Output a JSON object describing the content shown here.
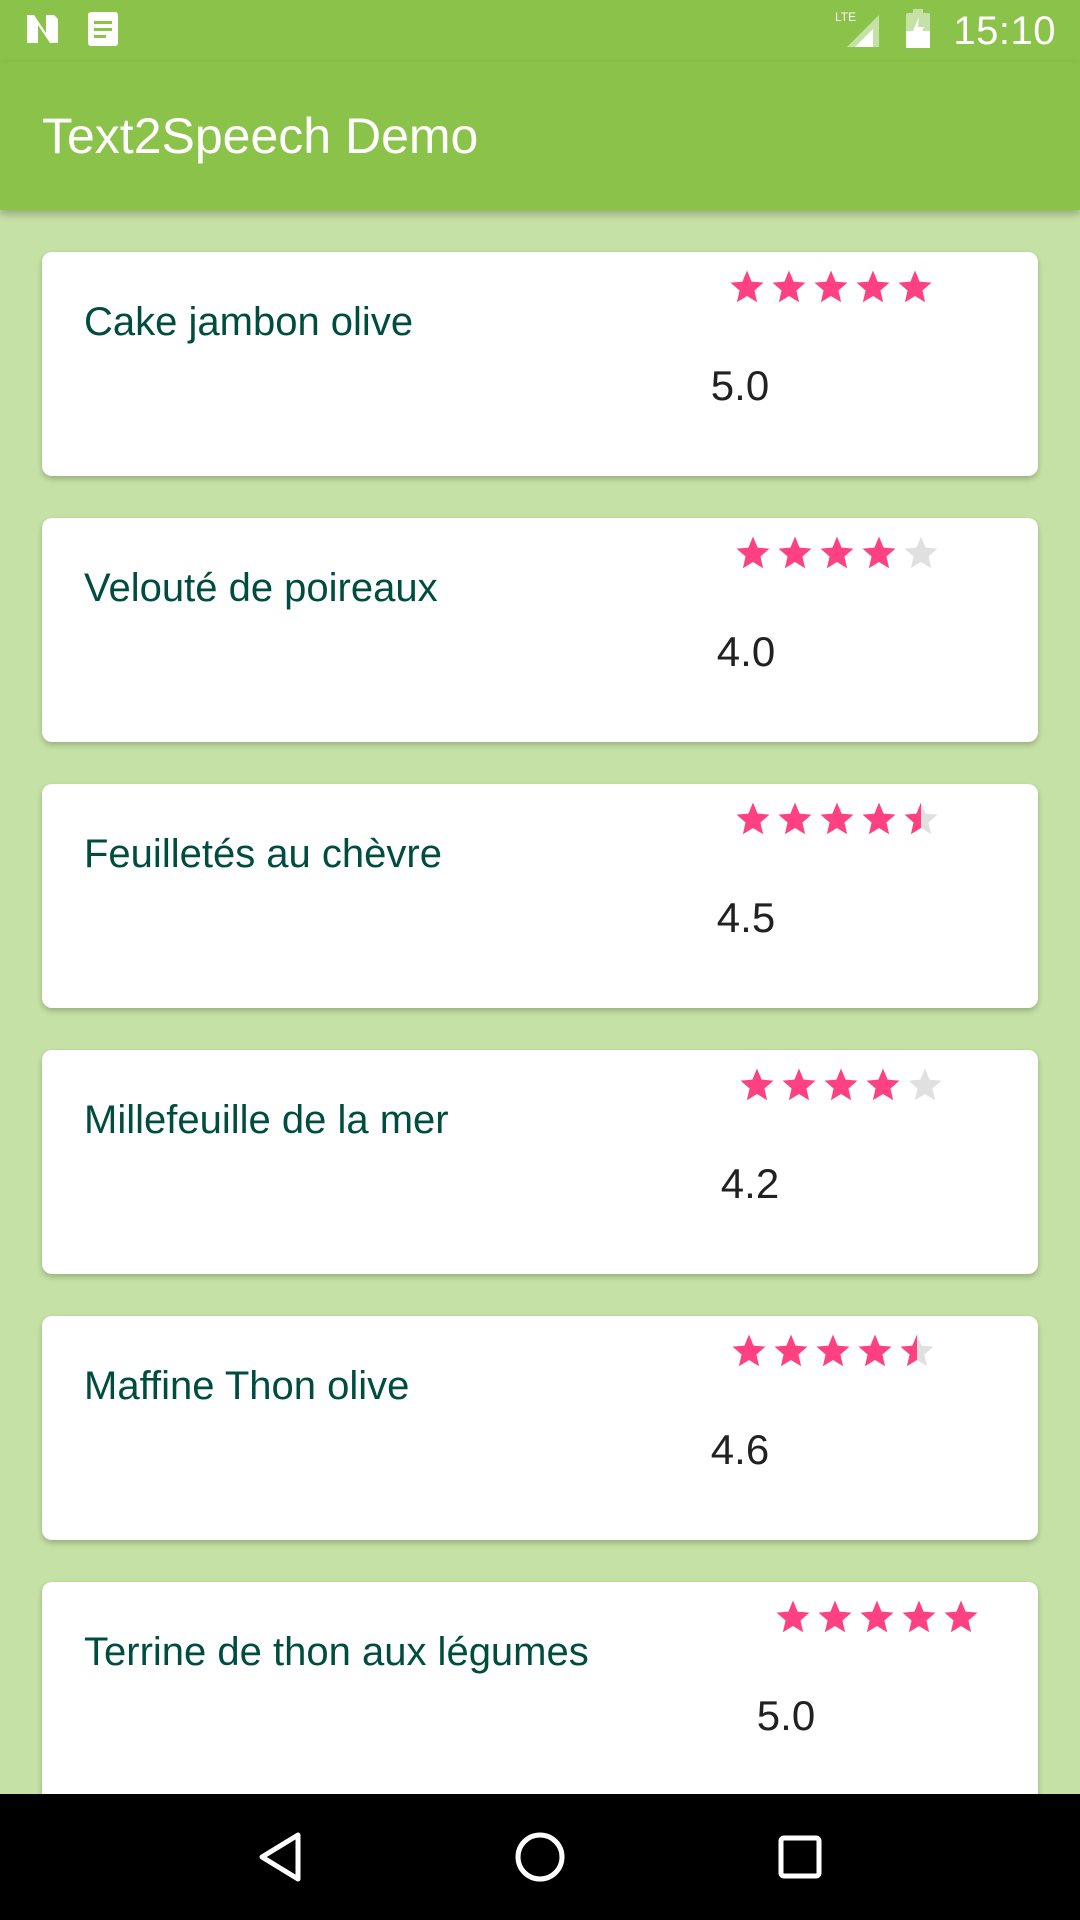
{
  "status_bar": {
    "time": "15:10",
    "network": "LTE"
  },
  "app_bar": {
    "title": "Text2Speech Demo"
  },
  "colors": {
    "primary": "#8bc34a",
    "background": "#c5e1a5",
    "star_filled": "#ff4081",
    "star_empty": "#e0e0e0",
    "item_text": "#004d40"
  },
  "items": [
    {
      "name": "Cake jambon olive",
      "rating": 5.0,
      "rating_label": "5.0"
    },
    {
      "name": "Velouté de poireaux",
      "rating": 4.0,
      "rating_label": "4.0"
    },
    {
      "name": "Feuilletés au chèvre",
      "rating": 4.5,
      "rating_label": "4.5"
    },
    {
      "name": "Millefeuille de la mer",
      "rating": 4.2,
      "rating_label": "4.2"
    },
    {
      "name": "Maffine Thon olive",
      "rating": 4.6,
      "rating_label": "4.6"
    },
    {
      "name": "Terrine de thon aux légumes",
      "rating": 5.0,
      "rating_label": "5.0"
    }
  ],
  "nav_bar": {
    "icons": [
      "back-icon",
      "home-icon",
      "recents-icon"
    ]
  }
}
